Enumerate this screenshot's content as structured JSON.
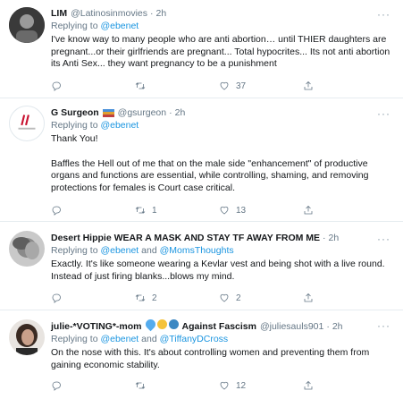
{
  "tweets": [
    {
      "name": "LIM",
      "handle": "@Latinosinmovies",
      "sep": "·",
      "time": "2h",
      "more": "···",
      "reply_prefix": "Replying to ",
      "reply_to": "@ebenet",
      "reply_and": "",
      "reply_to_2": "",
      "body": [
        "I've know way to many people who are anti abortion… until THIER daughters are pregnant...or their girlfriends are pregnant... Total hypocrites... Its not anti abortion its Anti Sex... they want pregnancy to be a punishment"
      ],
      "reply_count": "",
      "retweet_count": "",
      "like_count": "37"
    },
    {
      "name": "G Surgeon",
      "handle": "@gsurgeon",
      "sep": "·",
      "time": "2h",
      "more": "···",
      "reply_prefix": "Replying to ",
      "reply_to": "@ebenet",
      "reply_and": "",
      "reply_to_2": "",
      "body": [
        "Thank You!",
        "Baffles the Hell out of me that on the male side \"enhancement\" of productive organs and functions are essential, while controlling, shaming, and removing protections for females is Court case critical."
      ],
      "reply_count": "",
      "retweet_count": "1",
      "like_count": "13"
    },
    {
      "name": "Desert Hippie WEAR A MASK AND STAY TF AWAY FROM ME",
      "handle": "",
      "sep": "·",
      "time": "2h",
      "more": "···",
      "reply_prefix": "Replying to ",
      "reply_to": "@ebenet",
      "reply_and": " and ",
      "reply_to_2": "@MomsThoughts",
      "body": [
        "Exactly. It's like someone wearing a Kevlar vest and being shot with a live round. Instead of just firing blanks...blows my mind."
      ],
      "reply_count": "",
      "retweet_count": "2",
      "like_count": "2"
    },
    {
      "name": "julie-*VOTING*-mom",
      "name_suffix": "Against Fascism",
      "handle": "@juliesauls901",
      "sep": "·",
      "time": "2h",
      "more": "···",
      "reply_prefix": "Replying to ",
      "reply_to": "@ebenet",
      "reply_and": " and ",
      "reply_to_2": "@TiffanyDCross",
      "body": [
        "On the nose with this. It's about controlling women and preventing them from gaining economic stability."
      ],
      "reply_count": "",
      "retweet_count": "",
      "like_count": "12"
    }
  ],
  "colors": {
    "link": "#1b95e0",
    "muted": "#657786",
    "border": "#e6ecf0"
  },
  "icons": [
    "reply-icon",
    "retweet-icon",
    "like-icon",
    "share-icon",
    "more-icon"
  ]
}
